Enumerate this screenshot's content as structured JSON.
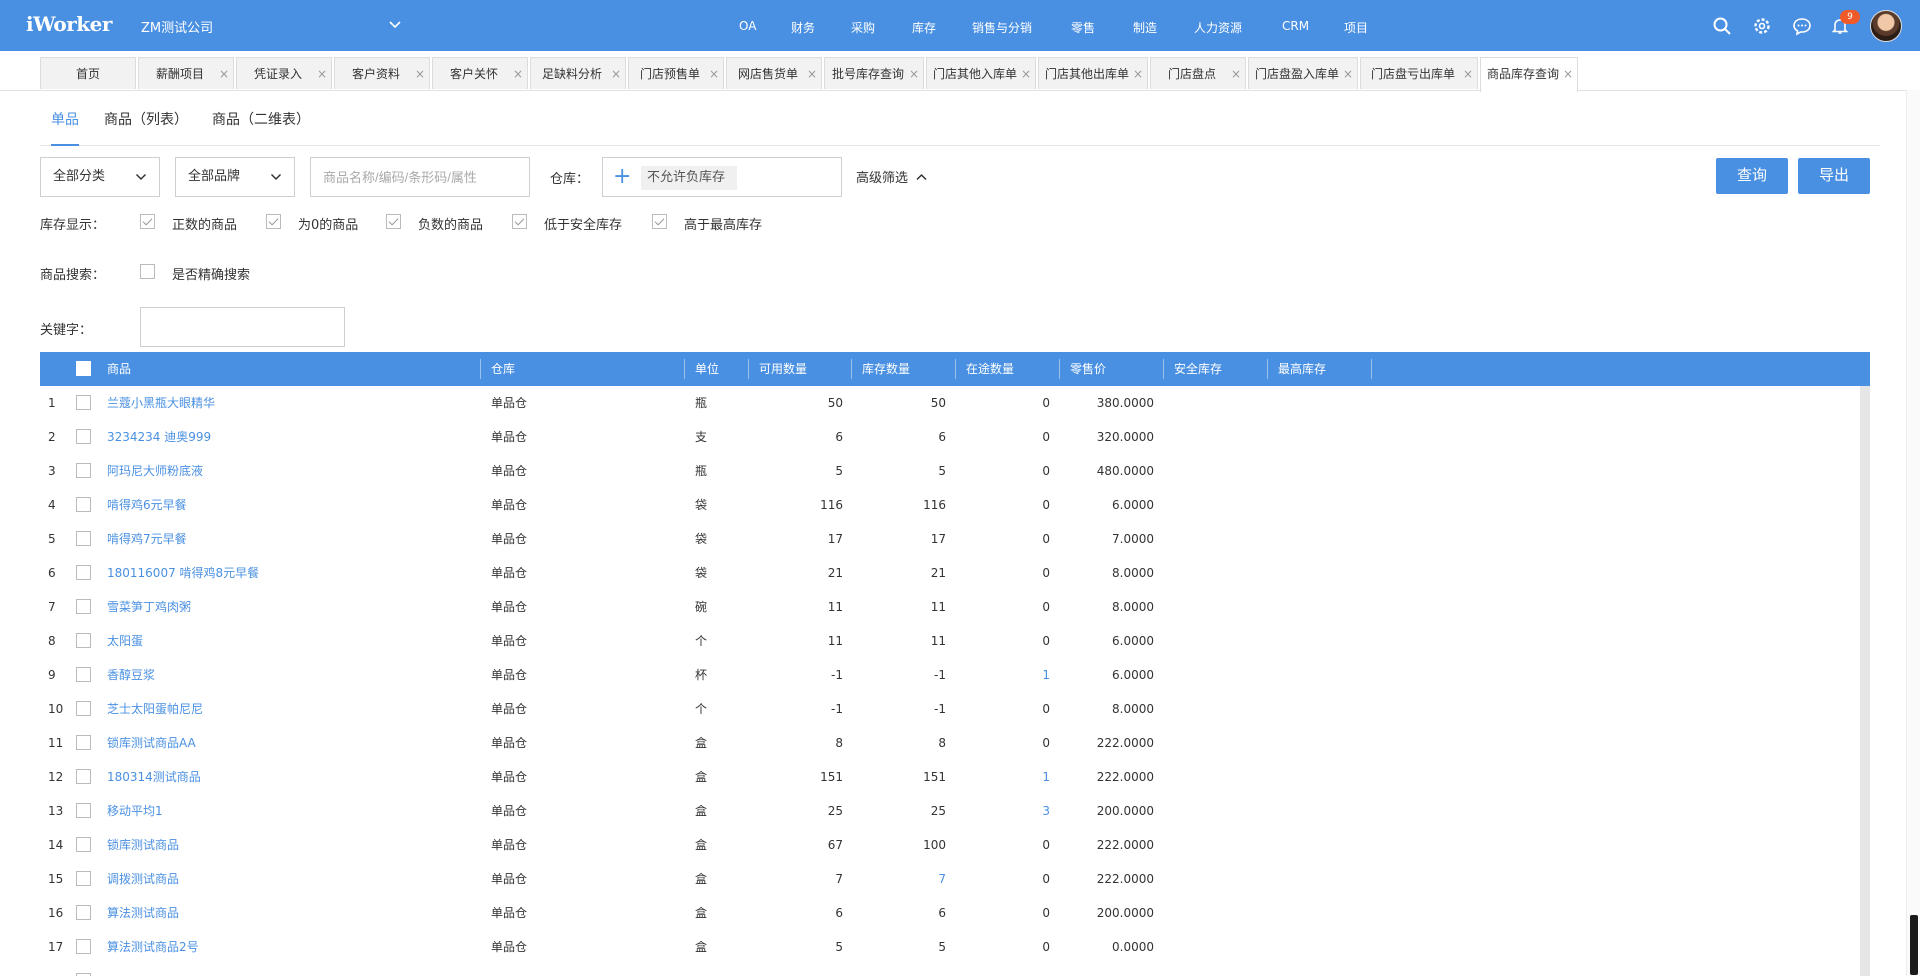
{
  "app": {
    "logo": "iWorker",
    "company": "ZM测试公司",
    "notification_count": "9"
  },
  "nav": [
    "OA",
    "财务",
    "采购",
    "库存",
    "销售与分销",
    "零售",
    "制造",
    "人力资源",
    "CRM",
    "项目"
  ],
  "tabs": [
    {
      "label": "首页"
    },
    {
      "label": "薪酬项目"
    },
    {
      "label": "凭证录入"
    },
    {
      "label": "客户资料"
    },
    {
      "label": "客户关怀"
    },
    {
      "label": "足缺料分析"
    },
    {
      "label": "门店预售单"
    },
    {
      "label": "网店售货单"
    },
    {
      "label": "批号库存查询"
    },
    {
      "label": "门店其他入库单"
    },
    {
      "label": "门店其他出库单"
    },
    {
      "label": "门店盘点"
    },
    {
      "label": "门店盘盈入库单"
    },
    {
      "label": "门店盘亏出库单"
    },
    {
      "label": "商品库存查询"
    }
  ],
  "close_glyph": "×",
  "subtabs": [
    "单品",
    "商品（列表）",
    "商品（二维表）"
  ],
  "filters": {
    "category": "全部分类",
    "brand": "全部品牌",
    "search_placeholder": "商品名称/编码/条形码/属性",
    "warehouse_label": "仓库：",
    "warehouse_tag": "不允许负库存",
    "advanced": "高级筛选",
    "query_button": "查询",
    "export_button": "导出"
  },
  "stock_display": {
    "label": "库存显示：",
    "options": [
      "正数的商品",
      "为0的商品",
      "负数的商品",
      "低于安全库存",
      "高于最高库存"
    ]
  },
  "product_search": {
    "label": "商品搜索：",
    "exact": "是否精确搜索"
  },
  "keyword": {
    "label": "关键字："
  },
  "table": {
    "headers": [
      "商品",
      "仓库",
      "单位",
      "可用数量",
      "库存数量",
      "在途数量",
      "零售价",
      "安全库存",
      "最高库存"
    ],
    "rows": [
      {
        "no": "1",
        "name": "兰蔻小黑瓶大眼精华",
        "wh": "单品仓",
        "unit": "瓶",
        "avail": "50",
        "stock": "50",
        "transit": "0",
        "price": "380.0000"
      },
      {
        "no": "2",
        "name": "3234234 迪奥999",
        "wh": "单品仓",
        "unit": "支",
        "avail": "6",
        "stock": "6",
        "transit": "0",
        "price": "320.0000"
      },
      {
        "no": "3",
        "name": "阿玛尼大师粉底液",
        "wh": "单品仓",
        "unit": "瓶",
        "avail": "5",
        "stock": "5",
        "transit": "0",
        "price": "480.0000"
      },
      {
        "no": "4",
        "name": "啃得鸡6元早餐",
        "wh": "单品仓",
        "unit": "袋",
        "avail": "116",
        "stock": "116",
        "transit": "0",
        "price": "6.0000"
      },
      {
        "no": "5",
        "name": "啃得鸡7元早餐",
        "wh": "单品仓",
        "unit": "袋",
        "avail": "17",
        "stock": "17",
        "transit": "0",
        "price": "7.0000"
      },
      {
        "no": "6",
        "name": "180116007 啃得鸡8元早餐",
        "wh": "单品仓",
        "unit": "袋",
        "avail": "21",
        "stock": "21",
        "transit": "0",
        "price": "8.0000"
      },
      {
        "no": "7",
        "name": "雪菜笋丁鸡肉粥",
        "wh": "单品仓",
        "unit": "碗",
        "avail": "11",
        "stock": "11",
        "transit": "0",
        "price": "8.0000"
      },
      {
        "no": "8",
        "name": "太阳蛋",
        "wh": "单品仓",
        "unit": "个",
        "avail": "11",
        "stock": "11",
        "transit": "0",
        "price": "6.0000"
      },
      {
        "no": "9",
        "name": "香醇豆浆",
        "wh": "单品仓",
        "unit": "杯",
        "avail": "-1",
        "stock": "-1",
        "transit": "1",
        "price": "6.0000"
      },
      {
        "no": "10",
        "name": "芝士太阳蛋帕尼尼",
        "wh": "单品仓",
        "unit": "个",
        "avail": "-1",
        "stock": "-1",
        "transit": "0",
        "price": "8.0000"
      },
      {
        "no": "11",
        "name": "锁库测试商品AA",
        "wh": "单品仓",
        "unit": "盒",
        "avail": "8",
        "stock": "8",
        "transit": "0",
        "price": "222.0000"
      },
      {
        "no": "12",
        "name": "180314测试商品",
        "wh": "单品仓",
        "unit": "盒",
        "avail": "151",
        "stock": "151",
        "transit": "1",
        "price": "222.0000"
      },
      {
        "no": "13",
        "name": "移动平均1",
        "wh": "单品仓",
        "unit": "盒",
        "avail": "25",
        "stock": "25",
        "transit": "3",
        "price": "200.0000"
      },
      {
        "no": "14",
        "name": "锁库测试商品",
        "wh": "单品仓",
        "unit": "盒",
        "avail": "67",
        "stock": "100",
        "transit": "0",
        "price": "222.0000"
      },
      {
        "no": "15",
        "name": "调拨测试商品",
        "wh": "单品仓",
        "unit": "盒",
        "avail": "7",
        "stock": "7",
        "transit": "0",
        "price": "222.0000"
      },
      {
        "no": "16",
        "name": "算法测试商品",
        "wh": "单品仓",
        "unit": "盒",
        "avail": "6",
        "stock": "6",
        "transit": "0",
        "price": "200.0000"
      },
      {
        "no": "17",
        "name": "算法测试商品2号",
        "wh": "单品仓",
        "unit": "盒",
        "avail": "5",
        "stock": "5",
        "transit": "0",
        "price": "0.0000"
      }
    ]
  },
  "colors": {
    "primary": "#4a90e2",
    "badge": "#f05a28"
  }
}
